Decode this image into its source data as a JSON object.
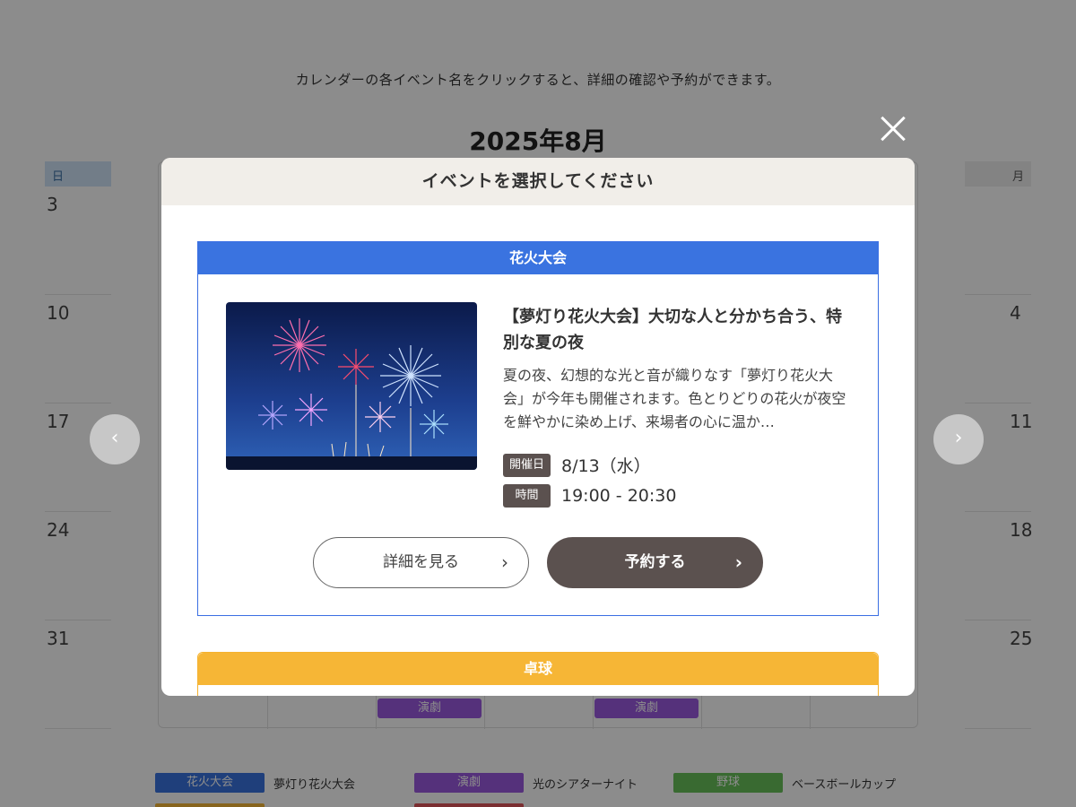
{
  "intro_text": "カレンダーの各イベント名をクリックすると、詳細の確認や予約ができます。",
  "calendar": {
    "month_title": "2025年8月",
    "left_dow": "日",
    "right_dow": "月",
    "left_days": [
      "3",
      "10",
      "17",
      "24",
      "31"
    ],
    "right_days": [
      "",
      "4",
      "11",
      "18",
      "25"
    ],
    "bottom_tags": [
      "演劇",
      "演劇"
    ]
  },
  "legend": [
    {
      "chip": "花火大会",
      "label": "夢灯り花火大会",
      "color": "#3a73e0"
    },
    {
      "chip": "演劇",
      "label": "光のシアターナイト",
      "color": "#9b59e0"
    },
    {
      "chip": "野球",
      "label": "ベースボールカップ",
      "color": "#69c15a"
    }
  ],
  "modal": {
    "title": "イベントを選択してください",
    "events": [
      {
        "category": "花火大会",
        "category_color": "#3a73e0",
        "title": "【夢灯り花火大会】大切な人と分かち合う、特別な夏の夜",
        "description": "夏の夜、幻想的な光と音が織りなす「夢灯り花火大会」が今年も開催されます。色とりどりの花火が夜空を鮮やかに染め上げ、来場者の心に温か…",
        "date_label": "開催日",
        "date_value": "8/13（水）",
        "time_label": "時間",
        "time_value": "19:00 - 20:30",
        "detail_button": "詳細を見る",
        "reserve_button": "予約する",
        "image_icon": "fireworks-photo"
      },
      {
        "category": "卓球",
        "category_color": "#f6b636"
      }
    ]
  }
}
